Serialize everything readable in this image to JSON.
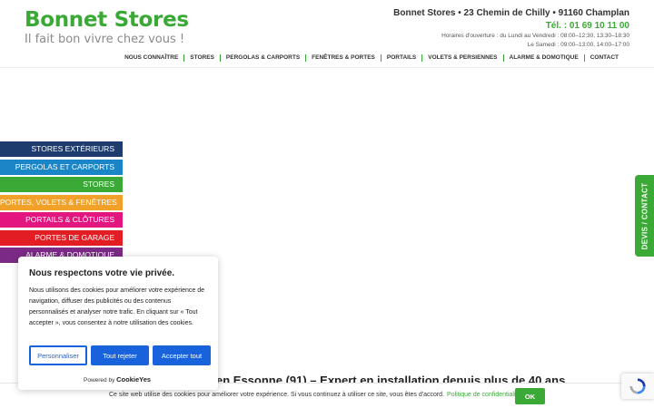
{
  "brand": {
    "name": "Bonnet Stores",
    "tagline": "Il fait bon vivre chez vous !",
    "accent": "#3aa935"
  },
  "contact": {
    "address": "Bonnet Stores • 23 Chemin de Chilly • 91160 Champlan",
    "phone": "Tél. : 01 69 10 11 00",
    "hours_weekday": "Horaires d'ouverture : du Lundi au Vendredi : 08:00–12:30, 13:30–18:30",
    "hours_saturday": "Le Samedi : 09:00–13:00, 14:00–17:00"
  },
  "nav": {
    "items": [
      "Nous connaître",
      "Stores",
      "Pergolas & Carports",
      "Fenêtres & Portes",
      "Portails",
      "Volets & Persiennes",
      "Alarme & Domotique",
      "Contact"
    ]
  },
  "categories": [
    {
      "label": "Stores extérieurs",
      "color": "#1e3d6e"
    },
    {
      "label": "Pergolas et carports",
      "color": "#1a86c8"
    },
    {
      "label": "Stores",
      "color": "#3aa935"
    },
    {
      "label": "Portes, volets & fenêtres",
      "color": "#f2a128"
    },
    {
      "label": "Portails & Clôtures",
      "color": "#e3157f"
    },
    {
      "label": "Portes de garage",
      "color": "#e31d24"
    },
    {
      "label": "Alarme & Domotique",
      "color": "#7b2a86"
    }
  ],
  "side_tab": {
    "label": "DEVIS / CONTACT"
  },
  "headline": "en Essonne (91) – Expert en installation depuis plus de 40 ans",
  "cookie_modal": {
    "title": "Nous respectons votre vie privée.",
    "text": "Nous utilisons des cookies pour améliorer votre expérience de navigation, diffuser des publicités ou des contenus personnalisés et analyser notre trafic. En cliquant sur « Tout accepter », vous consentez à notre utilisation des cookies.",
    "customize_label": "Personnaliser",
    "reject_label": "Tout rejeter",
    "accept_label": "Accepter tout",
    "powered_by": "Powered by",
    "powered_brand": "CookieYes",
    "button_color": "#1863dc"
  },
  "cookie_bar": {
    "text": "Ce site web utilise des cookies pour améliorer votre expérience. Si vous continuez à utiliser ce site, vous êtes d'accord.",
    "policy_link": "Politique de confidentialité",
    "ok_label": "OK"
  }
}
